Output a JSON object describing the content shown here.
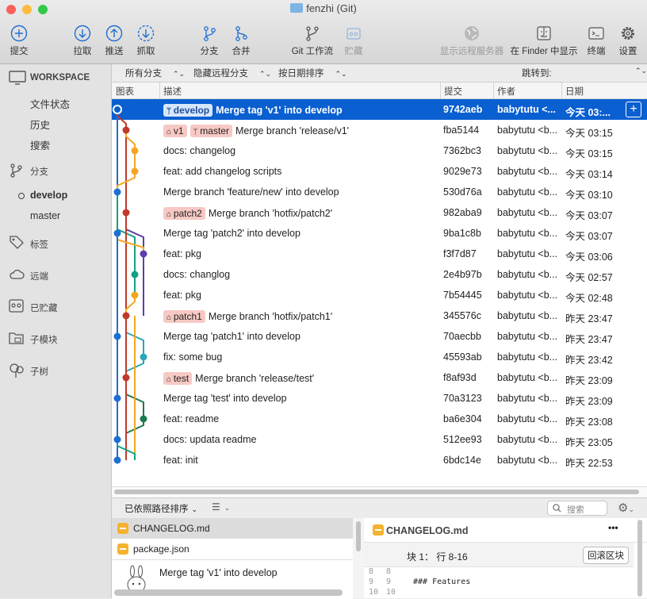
{
  "window": {
    "title": "fenzhi (Git)"
  },
  "toolbar": {
    "commit": "提交",
    "pull": "拉取",
    "push": "推送",
    "fetch": "抓取",
    "branch": "分支",
    "merge": "合并",
    "git_flow": "Git 工作流",
    "stash": "贮藏",
    "remote": "显示远程服务器",
    "finder": "在 Finder 中显示",
    "terminal": "终端",
    "settings": "设置"
  },
  "sidebar": {
    "workspace": "WORKSPACE",
    "file_status": "文件状态",
    "history": "历史",
    "search": "搜索",
    "branches": "分支",
    "branch_items": [
      "develop",
      "master"
    ],
    "tags": "标签",
    "remotes": "远端",
    "stashes": "已贮藏",
    "submodules": "子模块",
    "subtrees": "子树"
  },
  "filter": {
    "all_branches": "所有分支",
    "hide_remote": "隐藏远程分支",
    "sort_date": "按日期排序",
    "jump_to": "跳转到:"
  },
  "columns": {
    "graph": "图表",
    "description": "描述",
    "commit": "提交",
    "author": "作者",
    "date": "日期"
  },
  "commits": [
    {
      "tags": [
        {
          "t": "develop",
          "k": "branch"
        }
      ],
      "msg": "Merge tag 'v1' into develop",
      "hash": "9742aeb",
      "author": "babytutu <...",
      "date": "今天 03:..."
    },
    {
      "tags": [
        {
          "t": "v1",
          "k": "tag"
        },
        {
          "t": "master",
          "k": "branch"
        }
      ],
      "msg": "Merge branch 'release/v1'",
      "hash": "fba5144",
      "author": "babytutu <b...",
      "date": "今天 03:15"
    },
    {
      "tags": [],
      "msg": "docs: changelog",
      "hash": "7362bc3",
      "author": "babytutu <b...",
      "date": "今天 03:15"
    },
    {
      "tags": [],
      "msg": "feat: add changelog scripts",
      "hash": "9029e73",
      "author": "babytutu <b...",
      "date": "今天 03:14"
    },
    {
      "tags": [],
      "msg": "Merge branch 'feature/new' into develop",
      "hash": "530d76a",
      "author": "babytutu <b...",
      "date": "今天 03:10"
    },
    {
      "tags": [
        {
          "t": "patch2",
          "k": "tag"
        }
      ],
      "msg": "Merge branch 'hotfix/patch2'",
      "hash": "982aba9",
      "author": "babytutu <b...",
      "date": "今天 03:07"
    },
    {
      "tags": [],
      "msg": "Merge tag 'patch2' into develop",
      "hash": "9ba1c8b",
      "author": "babytutu <b...",
      "date": "今天 03:07"
    },
    {
      "tags": [],
      "msg": "feat: pkg",
      "hash": "f3f7d87",
      "author": "babytutu <b...",
      "date": "今天 03:06"
    },
    {
      "tags": [],
      "msg": "docs: changlog",
      "hash": "2e4b97b",
      "author": "babytutu <b...",
      "date": "今天 02:57"
    },
    {
      "tags": [],
      "msg": "feat: pkg",
      "hash": "7b54445",
      "author": "babytutu <b...",
      "date": "今天 02:48"
    },
    {
      "tags": [
        {
          "t": "patch1",
          "k": "tag"
        }
      ],
      "msg": "Merge branch 'hotfix/patch1'",
      "hash": "345576c",
      "author": "babytutu <b...",
      "date": "昨天 23:47"
    },
    {
      "tags": [],
      "msg": "Merge tag 'patch1' into develop",
      "hash": "70aecbb",
      "author": "babytutu <b...",
      "date": "昨天 23:47"
    },
    {
      "tags": [],
      "msg": "fix: some bug",
      "hash": "45593ab",
      "author": "babytutu <b...",
      "date": "昨天 23:42"
    },
    {
      "tags": [
        {
          "t": "test",
          "k": "tag"
        }
      ],
      "msg": "Merge branch 'release/test'",
      "hash": "f8af93d",
      "author": "babytutu <b...",
      "date": "昨天 23:09"
    },
    {
      "tags": [],
      "msg": "Merge tag 'test' into develop",
      "hash": "70a3123",
      "author": "babytutu <b...",
      "date": "昨天 23:09"
    },
    {
      "tags": [],
      "msg": "feat: readme",
      "hash": "ba6e304",
      "author": "babytutu <b...",
      "date": "昨天 23:08"
    },
    {
      "tags": [],
      "msg": "docs: updata readme",
      "hash": "512ee93",
      "author": "babytutu <b...",
      "date": "昨天 23:05"
    },
    {
      "tags": [],
      "msg": "feat: init",
      "hash": "6bdc14e",
      "author": "babytutu <b...",
      "date": "昨天 22:53"
    }
  ],
  "lane_colors": [
    "#1e6fd0",
    "#c0392b",
    "#f5a623",
    "#16a085",
    "#5b3ea8",
    "#2aa7b8",
    "#1e7a4a"
  ],
  "bottom": {
    "sort_label": "已依照路径排序",
    "search_placeholder": "搜索"
  },
  "files": [
    "CHANGELOG.md",
    "package.json"
  ],
  "commit_info": {
    "message": "Merge tag 'v1' into develop"
  },
  "diff": {
    "file": "CHANGELOG.md",
    "more": "•••",
    "hunk": "块 1： 行 8-16",
    "revert": "回滚区块",
    "lines": [
      {
        "a": "8",
        "b": "8",
        "text": ""
      },
      {
        "a": "9",
        "b": "9",
        "text": "### Features"
      },
      {
        "a": "10",
        "b": "10",
        "text": ""
      }
    ]
  }
}
